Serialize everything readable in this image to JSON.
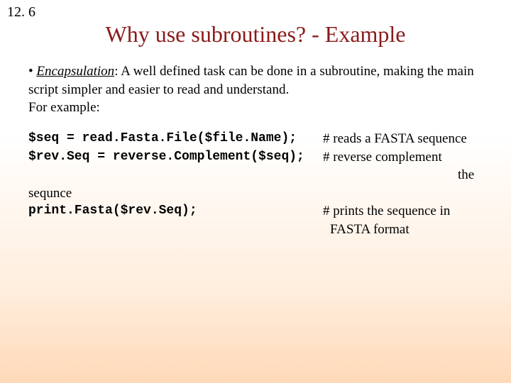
{
  "page_number": "12. 6",
  "title": "Why use subroutines? - Example",
  "bullet": "•",
  "def_term": "Encapsulation",
  "def_rest": ":  A well defined task can be done in a subroutine, making the main script simpler and easier to read and understand.",
  "for_example": "For example:",
  "code": {
    "l1_code": "$seq = read.Fasta.File($file.Name);",
    "l1_cmt": "# reads a FASTA sequence",
    "l2_code": "$rev.Seq = reverse.Complement($seq);",
    "l2_cmt": "# reverse complement",
    "l2b": "the",
    "l3a": "sequnce",
    "l4_code": "print.Fasta($rev.Seq);",
    "l4_cmt": "# prints the sequence in",
    "l5": "FASTA format"
  }
}
